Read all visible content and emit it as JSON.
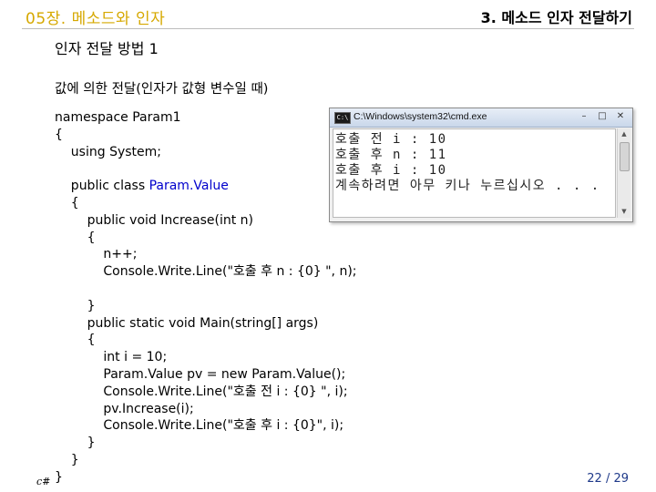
{
  "header": {
    "chapter": "05장. 메소드와 인자",
    "section": "3. 메소드 인자 전달하기"
  },
  "heading": "인자 전달 방법 1",
  "subheading": "값에 의한 전달(인자가 값형 변수일 때)",
  "code": [
    {
      "text": "namespace Param1"
    },
    {
      "text": "{"
    },
    {
      "text": "    using System;"
    },
    {
      "text": ""
    },
    {
      "text": "    public class ",
      "cls": "Param.Value"
    },
    {
      "text": "    {"
    },
    {
      "text": "        public void Increase(int n)"
    },
    {
      "text": "        {"
    },
    {
      "text": "            n++;"
    },
    {
      "text": "            Console.Write.Line(\"호출 후 n : {0} \", n);"
    },
    {
      "text": ""
    },
    {
      "text": "        }"
    },
    {
      "text": "        public static void Main(string[] args)"
    },
    {
      "text": "        {"
    },
    {
      "text": "            int i = 10;"
    },
    {
      "text": "            Param.Value pv = new Param.Value();"
    },
    {
      "text": "            Console.Write.Line(\"호출 전 i : {0} \", i);"
    },
    {
      "text": "            pv.Increase(i);"
    },
    {
      "text": "            Console.Write.Line(\"호출 후 i : {0}\", i);"
    },
    {
      "text": "        }"
    },
    {
      "text": "    }"
    },
    {
      "text": "}"
    }
  ],
  "console": {
    "title": "C:\\Windows\\system32\\cmd.exe",
    "icon_label": "C:\\",
    "lines": [
      "호출 전 i : 10",
      "호출 후 n : 11",
      "호출 후 i : 10",
      "계속하려면 아무 키나 누르십시오 . . ."
    ]
  },
  "footer": {
    "left": "c#",
    "page": "22 / 29"
  },
  "colors": {
    "chapter": "#d6a800",
    "class_name": "#0000cc",
    "page_number": "#1f3a8a"
  }
}
